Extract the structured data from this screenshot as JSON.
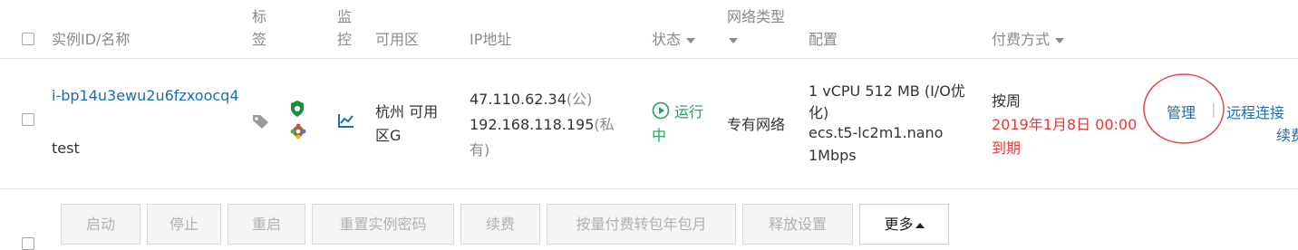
{
  "header": {
    "instance_id_name": "实例ID/名称",
    "tag_line1": "标",
    "tag_line2": "签",
    "monitor_line1": "监",
    "monitor_line2": "控",
    "zone": "可用区",
    "ip": "IP地址",
    "status": "状态",
    "network_line1": "网络类型",
    "config": "配置",
    "billing": "付费方式"
  },
  "row": {
    "instance_id": "i-bp14u3ewu2u6fzxoocq4",
    "instance_name": "test",
    "zone_line1": "杭州 可用",
    "zone_line2": "区G",
    "ip_public": "47.110.62.34",
    "ip_public_suffix": "(公)",
    "ip_private": "192.168.118.195",
    "ip_private_suffix1": "(私",
    "ip_private_suffix2": "有)",
    "status_line1": "运行",
    "status_line2": "中",
    "network": "专有网络",
    "config_line1": "1 vCPU 512 MB (I/O优",
    "config_line2": "化)",
    "config_line3": "ecs.t5-lc2m1.nano",
    "config_line4": "1Mbps",
    "billing_type": "按周",
    "expire_date": "2019年1月8日 00:00",
    "expire_suffix": "到期",
    "action_manage": "管理",
    "action_separator": "|",
    "action_remote": "远程连接",
    "action_renew_partial": "续费"
  },
  "footer_buttons": {
    "start": "启动",
    "stop": "停止",
    "restart": "重启",
    "reset_password": "重置实例密码",
    "renew": "续费",
    "convert": "按量付费转包年包月",
    "release": "释放设置",
    "more": "更多"
  },
  "colors": {
    "link": "#1c6cb3",
    "expire": "#e23a3a",
    "running": "#22a35a",
    "annotation_circle": "#e0484a"
  },
  "icons": [
    "tag-icon",
    "security-shield-icon",
    "settings-gear-icon",
    "monitor-chart-icon",
    "running-status-icon"
  ]
}
